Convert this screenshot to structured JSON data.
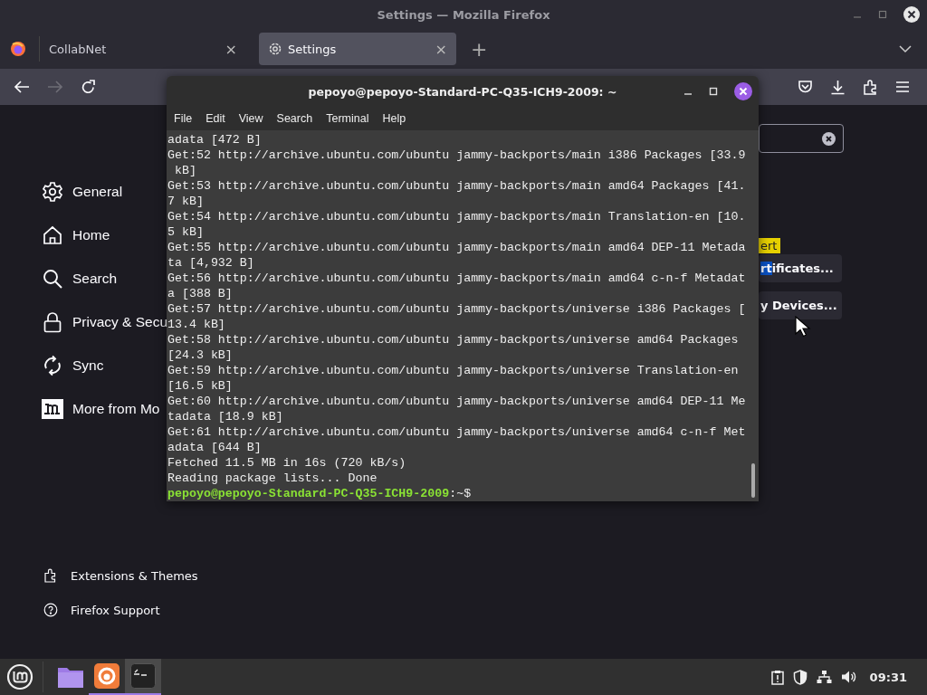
{
  "firefox": {
    "title": "Settings — Mozilla Firefox",
    "tabs": [
      {
        "label": "CollabNet",
        "selected": false,
        "kind": "plain",
        "close": "×"
      },
      {
        "label": "Settings",
        "selected": true,
        "kind": "settings",
        "close": "×"
      }
    ],
    "new_tab": "+",
    "nav": {
      "back_disabled": false,
      "forward_disabled": true
    },
    "sidebar": [
      {
        "label": "General",
        "kind": "gear"
      },
      {
        "label": "Home",
        "kind": "home"
      },
      {
        "label": "Search",
        "kind": "search"
      },
      {
        "label": "Privacy & Secu",
        "kind": "lock"
      },
      {
        "label": "Sync",
        "kind": "sync"
      },
      {
        "label": "More from Mo",
        "kind": "m"
      }
    ],
    "footer_links": [
      {
        "label": "Extensions & Themes",
        "kind": "puzzle"
      },
      {
        "label": "Firefox Support",
        "kind": "help"
      }
    ],
    "buttons": [
      {
        "highlight": "rt",
        "text": "ificates..."
      },
      {
        "text": "y Devices..."
      }
    ],
    "tooltip": "ert"
  },
  "terminal": {
    "title": "pepoyo@pepoyo-Standard-PC-Q35-ICH9-2009: ~",
    "menu": [
      "File",
      "Edit",
      "View",
      "Search",
      "Terminal",
      "Help"
    ],
    "lines": [
      "adata [472 B]",
      "Get:52 http://archive.ubuntu.com/ubuntu jammy-backports/main i386 Packages [33.9",
      " kB]",
      "Get:53 http://archive.ubuntu.com/ubuntu jammy-backports/main amd64 Packages [41.",
      "7 kB]",
      "Get:54 http://archive.ubuntu.com/ubuntu jammy-backports/main Translation-en [10.",
      "5 kB]",
      "Get:55 http://archive.ubuntu.com/ubuntu jammy-backports/main amd64 DEP-11 Metada",
      "ta [4,932 B]",
      "Get:56 http://archive.ubuntu.com/ubuntu jammy-backports/main amd64 c-n-f Metadat",
      "a [388 B]",
      "Get:57 http://archive.ubuntu.com/ubuntu jammy-backports/universe i386 Packages [",
      "13.4 kB]",
      "Get:58 http://archive.ubuntu.com/ubuntu jammy-backports/universe amd64 Packages",
      "[24.3 kB]",
      "Get:59 http://archive.ubuntu.com/ubuntu jammy-backports/universe Translation-en",
      "[16.5 kB]",
      "Get:60 http://archive.ubuntu.com/ubuntu jammy-backports/universe amd64 DEP-11 Me",
      "tadata [18.9 kB]",
      "Get:61 http://archive.ubuntu.com/ubuntu jammy-backports/universe amd64 c-n-f Met",
      "adata [644 B]",
      "Fetched 11.5 MB in 16s (720 kB/s)",
      "Reading package lists... Done"
    ],
    "prompt": {
      "user": "pepoyo@pepoyo-Standard-PC-Q35-ICH9-2009",
      "path": ":~$"
    }
  },
  "taskbar": {
    "apps": [
      {
        "kind": "folder",
        "running": false,
        "selected": false
      },
      {
        "kind": "firefox",
        "running": true,
        "selected": false
      },
      {
        "kind": "terminal",
        "running": true,
        "selected": true
      }
    ],
    "clock": "09:31"
  }
}
